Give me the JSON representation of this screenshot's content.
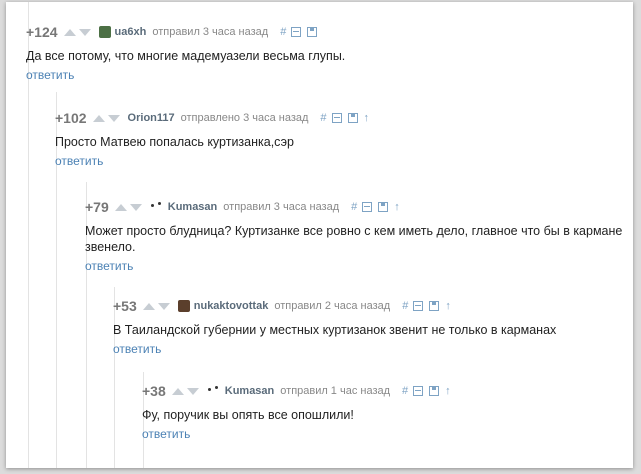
{
  "comments": [
    {
      "rating": "+124",
      "author": "ua6xh",
      "action": "отправил",
      "time": "3 часа назад",
      "hash": "#",
      "text": "Да все потому, что многие мадемуазели весьма глупы.",
      "reply": "ответить"
    },
    {
      "rating": "+102",
      "author": "Orion117",
      "action": "отправлено",
      "time": "3 часа назад",
      "hash": "#",
      "text": "Просто Матвею попалась куртизанка,сэр",
      "reply": "ответить"
    },
    {
      "rating": "+79",
      "author": "Kumasan",
      "action": "отправил",
      "time": "3 часа назад",
      "hash": "#",
      "text": "Может просто блудница? Куртизанке все ровно с кем иметь дело, главное что бы в кармане звенело.",
      "reply": "ответить"
    },
    {
      "rating": "+53",
      "author": "nukaktovottak",
      "action": "отправил",
      "time": "2 часа назад",
      "hash": "#",
      "text": "В Таиландской губернии у местных куртизанок звенит не только в карманах",
      "reply": "ответить"
    },
    {
      "rating": "+38",
      "author": "Kumasan",
      "action": "отправил",
      "time": "1 час назад",
      "hash": "#",
      "text": "Фу, поручик вы опять все опошлили!",
      "reply": "ответить"
    }
  ],
  "icons": {
    "upvote": "arrow-up-icon",
    "downvote": "arrow-down-icon",
    "minus": "collapse-icon",
    "save": "save-icon",
    "parent": "parent-arrow-icon"
  },
  "colors": {
    "author": "#5a6b7a",
    "link": "#4b81b4",
    "rating": "#777777"
  }
}
